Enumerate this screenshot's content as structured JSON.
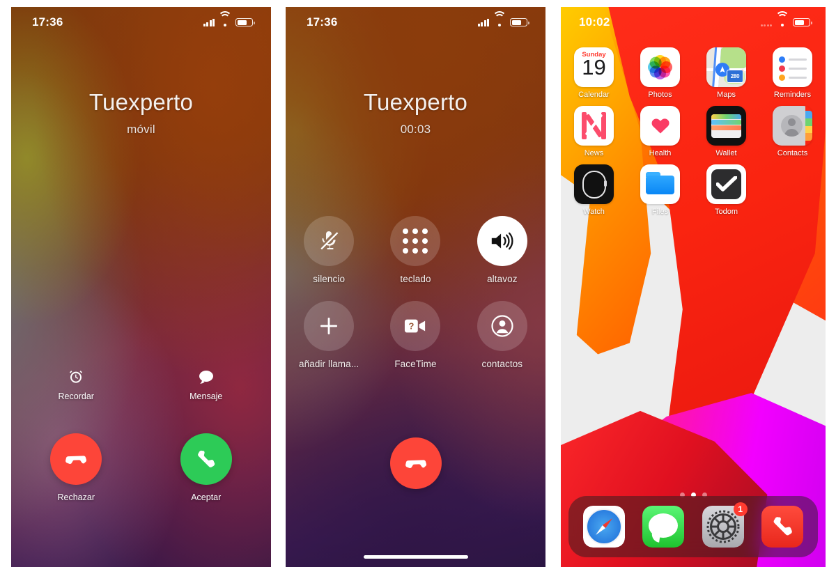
{
  "panels": {
    "incoming_call": {
      "status_bar": {
        "time": "17:36",
        "signal_icon": "cellular-signal-icon",
        "wifi_icon": "wifi-icon",
        "battery_icon": "battery-icon"
      },
      "caller_name": "Tuexperto",
      "caller_subtitle": "móvil",
      "small_actions": [
        {
          "label": "Recordar",
          "icon": "alarm-clock-icon"
        },
        {
          "label": "Mensaje",
          "icon": "message-bubble-icon"
        }
      ],
      "answer_actions": [
        {
          "label": "Rechazar",
          "icon": "decline-call-icon",
          "color": "#fd4539"
        },
        {
          "label": "Aceptar",
          "icon": "accept-call-icon",
          "color": "#2dcb57"
        }
      ]
    },
    "active_call": {
      "status_bar": {
        "time": "17:36",
        "signal_icon": "cellular-signal-icon",
        "wifi_icon": "wifi-icon",
        "battery_icon": "battery-icon"
      },
      "caller_name": "Tuexperto",
      "call_duration": "00:03",
      "controls": [
        {
          "label": "silencio",
          "icon": "microphone-muted-icon",
          "active": false
        },
        {
          "label": "teclado",
          "icon": "keypad-icon",
          "active": false
        },
        {
          "label": "altavoz",
          "icon": "speaker-icon",
          "active": true
        },
        {
          "label": "añadir llama...",
          "icon": "plus-icon",
          "active": false
        },
        {
          "label": "FaceTime",
          "icon": "facetime-video-icon",
          "active": false
        },
        {
          "label": "contactos",
          "icon": "contacts-person-icon",
          "active": false
        }
      ],
      "end_call": {
        "label": "end-call",
        "icon": "decline-call-icon",
        "color": "#fd4539"
      }
    },
    "home_screen": {
      "status_bar": {
        "time": "10:02",
        "signal_icon": "cellular-signal-dim-icon",
        "wifi_icon": "wifi-icon",
        "battery_icon": "battery-icon"
      },
      "apps": [
        [
          {
            "label": "Calendar",
            "icon": "calendar-icon",
            "day": "Sunday",
            "date": "19"
          },
          {
            "label": "Photos",
            "icon": "photos-icon"
          },
          {
            "label": "Maps",
            "icon": "maps-icon",
            "route_number": "280"
          },
          {
            "label": "Reminders",
            "icon": "reminders-icon"
          }
        ],
        [
          {
            "label": "News",
            "icon": "news-icon"
          },
          {
            "label": "Health",
            "icon": "health-icon"
          },
          {
            "label": "Wallet",
            "icon": "wallet-icon"
          },
          {
            "label": "Contacts",
            "icon": "contacts-icon"
          }
        ],
        [
          {
            "label": "Watch",
            "icon": "watch-icon"
          },
          {
            "label": "Files",
            "icon": "files-icon"
          },
          {
            "label": "Todom",
            "icon": "todom-icon"
          },
          {
            "label": "",
            "icon": ""
          }
        ]
      ],
      "page_dots": {
        "count": 3,
        "active_index": 1
      },
      "dock": [
        {
          "label": "Safari",
          "icon": "safari-icon",
          "badge": ""
        },
        {
          "label": "Messages",
          "icon": "messages-icon",
          "badge": ""
        },
        {
          "label": "Settings",
          "icon": "settings-gear-icon",
          "badge": "1"
        },
        {
          "label": "Phone",
          "icon": "phone-icon",
          "badge": ""
        }
      ]
    }
  },
  "colors": {
    "decline_red": "#fd4539",
    "accept_green": "#2dcb57",
    "badge_red": "#ff3b30",
    "wallpaper_orange": "#ff5a00",
    "wallpaper_red": "#ee1b10",
    "wallpaper_magenta": "#f200ff"
  }
}
